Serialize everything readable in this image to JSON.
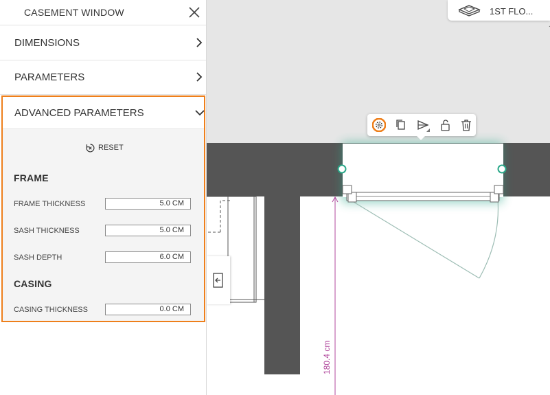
{
  "panel": {
    "title": "CASEMENT WINDOW",
    "sections": [
      {
        "label": "DIMENSIONS"
      },
      {
        "label": "PARAMETERS"
      }
    ],
    "advanced": {
      "label": "ADVANCED PARAMETERS",
      "reset_label": "RESET",
      "frame_title": "FRAME",
      "casing_title": "CASING",
      "fields": {
        "frame_thickness": {
          "label": "FRAME THICKNESS",
          "value": "5.0  CM"
        },
        "sash_thickness": {
          "label": "SASH THICKNESS",
          "value": "5.0  CM"
        },
        "sash_depth": {
          "label": "SASH DEPTH",
          "value": "6.0  CM"
        },
        "casing_thickness": {
          "label": "CASING THICKNESS",
          "value": "0.0  CM"
        }
      }
    }
  },
  "canvas": {
    "floor_label": "1ST FLO...",
    "dimension": "180.4 cm"
  },
  "colors": {
    "accent": "#ee7f1b",
    "wall": "#555555",
    "selection": "#2aa889",
    "dimension": "#b0479c"
  }
}
